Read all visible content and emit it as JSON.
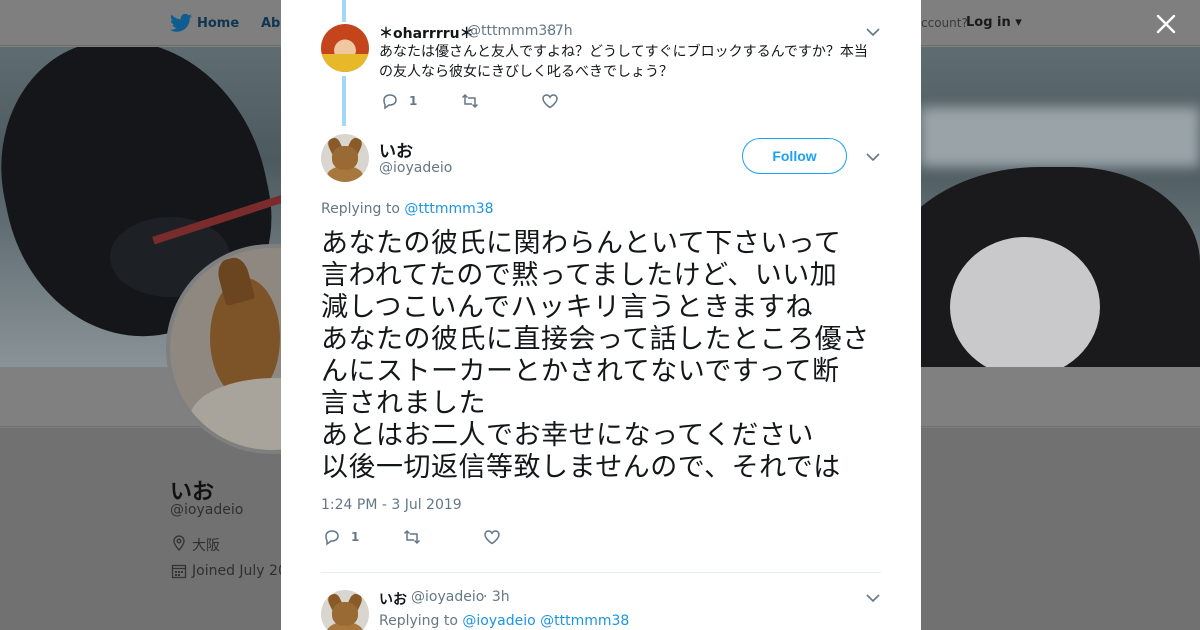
{
  "background": {
    "nav": {
      "home": "Home",
      "about": "Abo",
      "account": "ccount?",
      "login": "Log in"
    },
    "profile": {
      "name": "いお",
      "handle": "@ioyadeio",
      "location": "大阪",
      "joined": "Joined July 20"
    }
  },
  "colors": {
    "accent": "#1da1f2",
    "link": "#1b95e0",
    "thread_line": "#a4d8f5",
    "muted": "#657786"
  },
  "modal": {
    "reply_tweet": {
      "name": "＊oharrrru＊",
      "handle": "@tttmmm38",
      "time": "· 7h",
      "text_lines": [
        "あなたは優さんと友人ですよね？どうしてすぐにブロックするんですか？本当",
        "の友人なら彼女にきびしく叱るべきでしょう？"
      ],
      "reply_count": "1",
      "retweet_count": "",
      "like_count": ""
    },
    "main_tweet": {
      "name": "いお",
      "handle": "@ioyadeio",
      "follow_label": "Follow",
      "replying_prefix": "Replying to",
      "replying_to": "@tttmmm38",
      "text_lines": [
        "あなたの彼氏に関わらんといて下さいって",
        "言われてたので黙ってましたけど、いい加",
        "減しつこいんでハッキリ言うときますね",
        "あなたの彼氏に直接会って話したところ優さ",
        "んにストーカーとかされてないですって断",
        "言されました",
        "あとはお二人でお幸せになってください",
        "以後一切返信等致しませんので、それでは"
      ],
      "timestamp": "1:24 PM - 3 Jul 2019",
      "reply_count": "1"
    },
    "next_tweet": {
      "name": "いお",
      "handle": "@ioyadeio",
      "time": "· 3h",
      "replying_prefix": "Replying to",
      "replying_to_1": "@ioyadeio",
      "replying_to_2": "@tttmmm38"
    }
  },
  "icons": [
    "twitter-bird-icon",
    "close-icon",
    "chevron-down-icon",
    "reply-icon",
    "retweet-icon",
    "like-icon",
    "location-icon",
    "calendar-icon"
  ]
}
